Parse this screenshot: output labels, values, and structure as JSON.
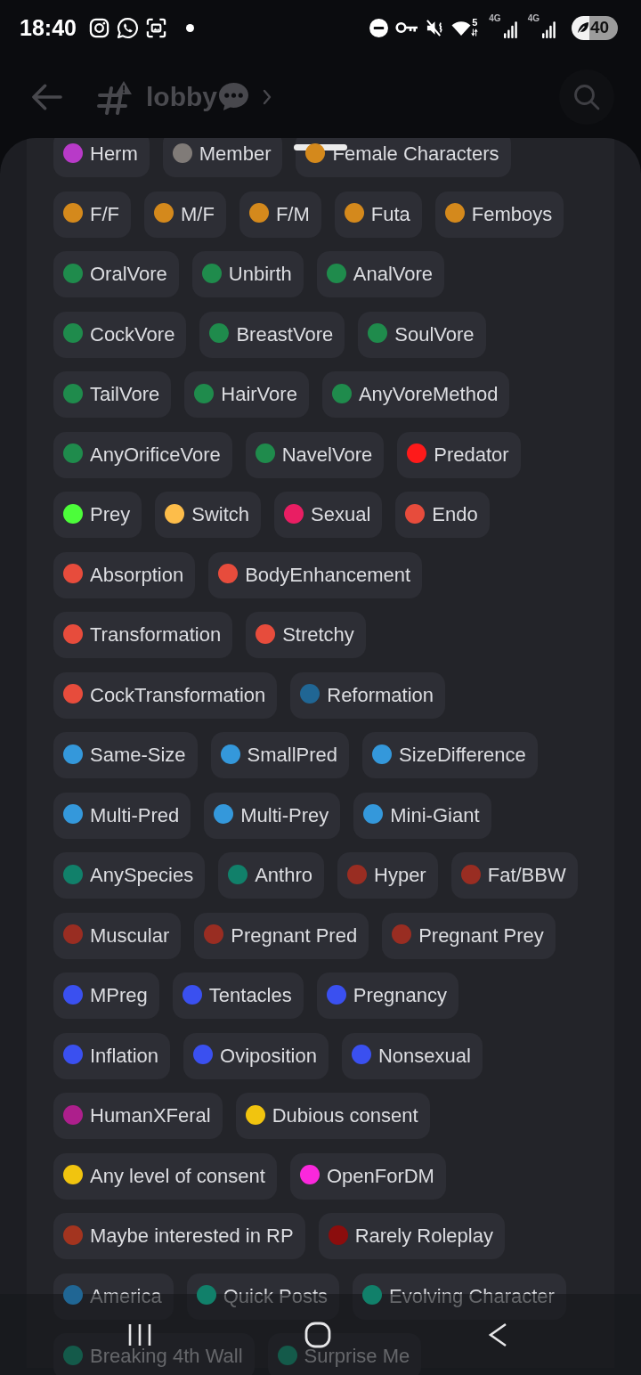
{
  "status_bar": {
    "time": "18:40",
    "wifi_label": "5",
    "network_labels": [
      "4G",
      "4G"
    ],
    "battery": "40"
  },
  "header": {
    "channel_name": "lobby"
  },
  "roles": [
    {
      "name": "Herm",
      "color": "#b83ac8"
    },
    {
      "name": "Member",
      "color": "#807b78"
    },
    {
      "name": "Female Characters",
      "color": "#d4891c"
    },
    {
      "name": "F/F",
      "color": "#d4891c"
    },
    {
      "name": "M/F",
      "color": "#d4891c"
    },
    {
      "name": "F/M",
      "color": "#d4891c"
    },
    {
      "name": "Futa",
      "color": "#d4891c"
    },
    {
      "name": "Femboys",
      "color": "#d4891c"
    },
    {
      "name": "OralVore",
      "color": "#1f8b4c"
    },
    {
      "name": "Unbirth",
      "color": "#1f8b4c"
    },
    {
      "name": "AnalVore",
      "color": "#1f8b4c"
    },
    {
      "name": "CockVore",
      "color": "#1f8b4c"
    },
    {
      "name": "BreastVore",
      "color": "#1f8b4c"
    },
    {
      "name": "SoulVore",
      "color": "#1f8b4c"
    },
    {
      "name": "TailVore",
      "color": "#1f8b4c"
    },
    {
      "name": "HairVore",
      "color": "#1f8b4c"
    },
    {
      "name": "AnyVoreMethod",
      "color": "#1f8b4c"
    },
    {
      "name": "AnyOrificeVore",
      "color": "#1f8b4c"
    },
    {
      "name": "NavelVore",
      "color": "#1f8b4c"
    },
    {
      "name": "Predator",
      "color": "#fe1a1a"
    },
    {
      "name": "Prey",
      "color": "#4cfd3a"
    },
    {
      "name": "Switch",
      "color": "#fdbd4a"
    },
    {
      "name": "Sexual",
      "color": "#e91e63"
    },
    {
      "name": "Endo",
      "color": "#e74c3c"
    },
    {
      "name": "Absorption",
      "color": "#e74c3c"
    },
    {
      "name": "BodyEnhancement",
      "color": "#e74c3c"
    },
    {
      "name": "Transformation",
      "color": "#e74c3c"
    },
    {
      "name": "Stretchy",
      "color": "#e74c3c"
    },
    {
      "name": "CockTransformation",
      "color": "#e74c3c"
    },
    {
      "name": "Reformation",
      "color": "#206694"
    },
    {
      "name": "Same-Size",
      "color": "#3498db"
    },
    {
      "name": "SmallPred",
      "color": "#3498db"
    },
    {
      "name": "SizeDifference",
      "color": "#3498db"
    },
    {
      "name": "Multi-Pred",
      "color": "#3498db"
    },
    {
      "name": "Multi-Prey",
      "color": "#3498db"
    },
    {
      "name": "Mini-Giant",
      "color": "#3498db"
    },
    {
      "name": "AnySpecies",
      "color": "#11806a"
    },
    {
      "name": "Anthro",
      "color": "#11806a"
    },
    {
      "name": "Hyper",
      "color": "#992d22"
    },
    {
      "name": "Fat/BBW",
      "color": "#992d22"
    },
    {
      "name": "Muscular",
      "color": "#992d22"
    },
    {
      "name": "Pregnant Pred",
      "color": "#992d22"
    },
    {
      "name": "Pregnant Prey",
      "color": "#992d22"
    },
    {
      "name": "MPreg",
      "color": "#3a50f0"
    },
    {
      "name": "Tentacles",
      "color": "#3a50f0"
    },
    {
      "name": "Pregnancy",
      "color": "#3a50f0"
    },
    {
      "name": "Inflation",
      "color": "#3a50f0"
    },
    {
      "name": "Oviposition",
      "color": "#3a50f0"
    },
    {
      "name": "Nonsexual",
      "color": "#3a50f0"
    },
    {
      "name": "HumanXFeral",
      "color": "#ad1f8c"
    },
    {
      "name": "Dubious consent",
      "color": "#f1c40f"
    },
    {
      "name": "Any level of consent",
      "color": "#f1c40f"
    },
    {
      "name": "OpenForDM",
      "color": "#fa28dc"
    },
    {
      "name": "Maybe interested in RP",
      "color": "#a3341f"
    },
    {
      "name": "Rarely Roleplay",
      "color": "#8b0d0d"
    },
    {
      "name": "America",
      "color": "#206694"
    },
    {
      "name": "Quick Posts",
      "color": "#11806a"
    },
    {
      "name": "Evolving Character",
      "color": "#11806a"
    },
    {
      "name": "Breaking 4th Wall",
      "color": "#145a4a"
    },
    {
      "name": "Surprise Me",
      "color": "#145a4a"
    }
  ]
}
